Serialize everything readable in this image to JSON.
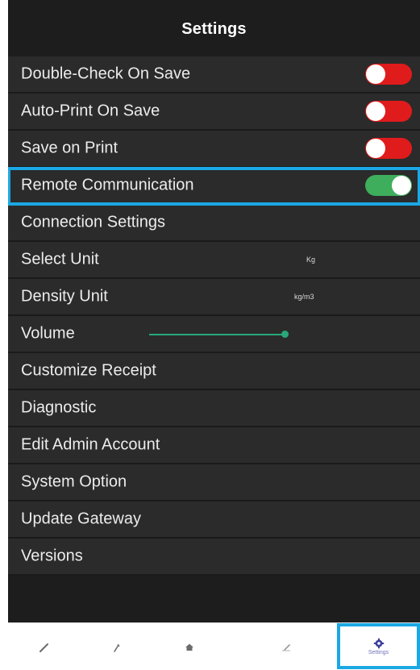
{
  "header": {
    "title": "Settings"
  },
  "settings": {
    "double_check": {
      "label": "Double-Check On Save",
      "enabled": false
    },
    "auto_print": {
      "label": "Auto-Print On Save",
      "enabled": false
    },
    "save_on_print": {
      "label": "Save on Print",
      "enabled": false
    },
    "remote_comm": {
      "label": "Remote Communication",
      "enabled": true
    },
    "connection": {
      "label": "Connection Settings"
    },
    "select_unit": {
      "label": "Select Unit",
      "value": "Kg"
    },
    "density_unit": {
      "label": "Density Unit",
      "value": "kg/m3"
    },
    "volume": {
      "label": "Volume",
      "level": 1.0
    },
    "customize_receipt": {
      "label": "Customize Receipt"
    },
    "diagnostic": {
      "label": "Diagnostic"
    },
    "edit_admin": {
      "label": "Edit Admin Account"
    },
    "system_option": {
      "label": "System Option"
    },
    "update_gateway": {
      "label": "Update Gateway"
    },
    "versions": {
      "label": "Versions"
    }
  },
  "tabbar": {
    "tabs": [
      {
        "icon": "pencil-icon"
      },
      {
        "icon": "pin-icon"
      },
      {
        "icon": "home-icon"
      },
      {
        "icon": "edit-icon"
      },
      {
        "icon": "gear-icon",
        "label": "Settings",
        "active": true
      }
    ]
  },
  "colors": {
    "toggle_off": "#e01b1b",
    "toggle_on": "#3fae5c",
    "highlight": "#1ba8e4",
    "slider": "#27a77a",
    "active_tab": "#6e74b8"
  }
}
